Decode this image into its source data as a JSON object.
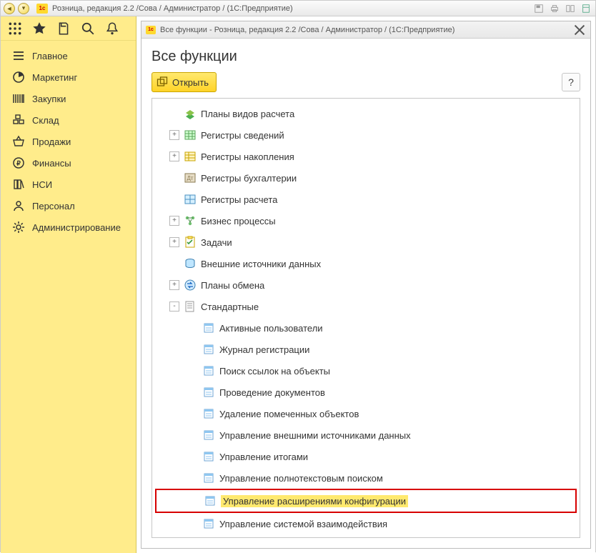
{
  "app": {
    "title": "Розница, редакция 2.2 /Сова / Администратор /  (1С:Предприятие)"
  },
  "sidebar": {
    "items": [
      {
        "label": "Главное"
      },
      {
        "label": "Маркетинг"
      },
      {
        "label": "Закупки"
      },
      {
        "label": "Склад"
      },
      {
        "label": "Продажи"
      },
      {
        "label": "Финансы"
      },
      {
        "label": "НСИ"
      },
      {
        "label": "Персонал"
      },
      {
        "label": "Администрирование"
      }
    ]
  },
  "inner": {
    "title": "Все функции - Розница, редакция 2.2 /Сова / Администратор /  (1С:Предприятие)",
    "heading": "Все функции",
    "open_label": "Открыть",
    "help_label": "?"
  },
  "tree": [
    {
      "level": 0,
      "expander": "",
      "kind": "calc",
      "label": "Планы видов расчета"
    },
    {
      "level": 0,
      "expander": "+",
      "kind": "reg",
      "label": "Регистры сведений"
    },
    {
      "level": 0,
      "expander": "+",
      "kind": "accum",
      "label": "Регистры накопления"
    },
    {
      "level": 0,
      "expander": "",
      "kind": "book",
      "label": "Регистры бухгалтерии"
    },
    {
      "level": 0,
      "expander": "",
      "kind": "rcalc",
      "label": "Регистры расчета"
    },
    {
      "level": 0,
      "expander": "+",
      "kind": "biz",
      "label": "Бизнес процессы"
    },
    {
      "level": 0,
      "expander": "+",
      "kind": "task",
      "label": "Задачи"
    },
    {
      "level": 0,
      "expander": "",
      "kind": "ext",
      "label": "Внешние источники данных"
    },
    {
      "level": 0,
      "expander": "+",
      "kind": "exch",
      "label": "Планы обмена"
    },
    {
      "level": 0,
      "expander": "-",
      "kind": "std",
      "label": "Стандартные"
    },
    {
      "level": 1,
      "expander": "",
      "kind": "dp",
      "label": "Активные пользователи"
    },
    {
      "level": 1,
      "expander": "",
      "kind": "dp",
      "label": "Журнал регистрации"
    },
    {
      "level": 1,
      "expander": "",
      "kind": "dp",
      "label": "Поиск ссылок на объекты"
    },
    {
      "level": 1,
      "expander": "",
      "kind": "dp",
      "label": "Проведение документов"
    },
    {
      "level": 1,
      "expander": "",
      "kind": "dp",
      "label": "Удаление помеченных объектов"
    },
    {
      "level": 1,
      "expander": "",
      "kind": "dp",
      "label": "Управление внешними источниками данных"
    },
    {
      "level": 1,
      "expander": "",
      "kind": "dp",
      "label": "Управление итогами"
    },
    {
      "level": 1,
      "expander": "",
      "kind": "dp",
      "label": "Управление полнотекстовым поиском"
    },
    {
      "level": 1,
      "expander": "",
      "kind": "dp",
      "label": "Управление расширениями конфигурации",
      "selected": true
    },
    {
      "level": 1,
      "expander": "",
      "kind": "dp",
      "label": "Управление системой взаимодействия"
    }
  ]
}
